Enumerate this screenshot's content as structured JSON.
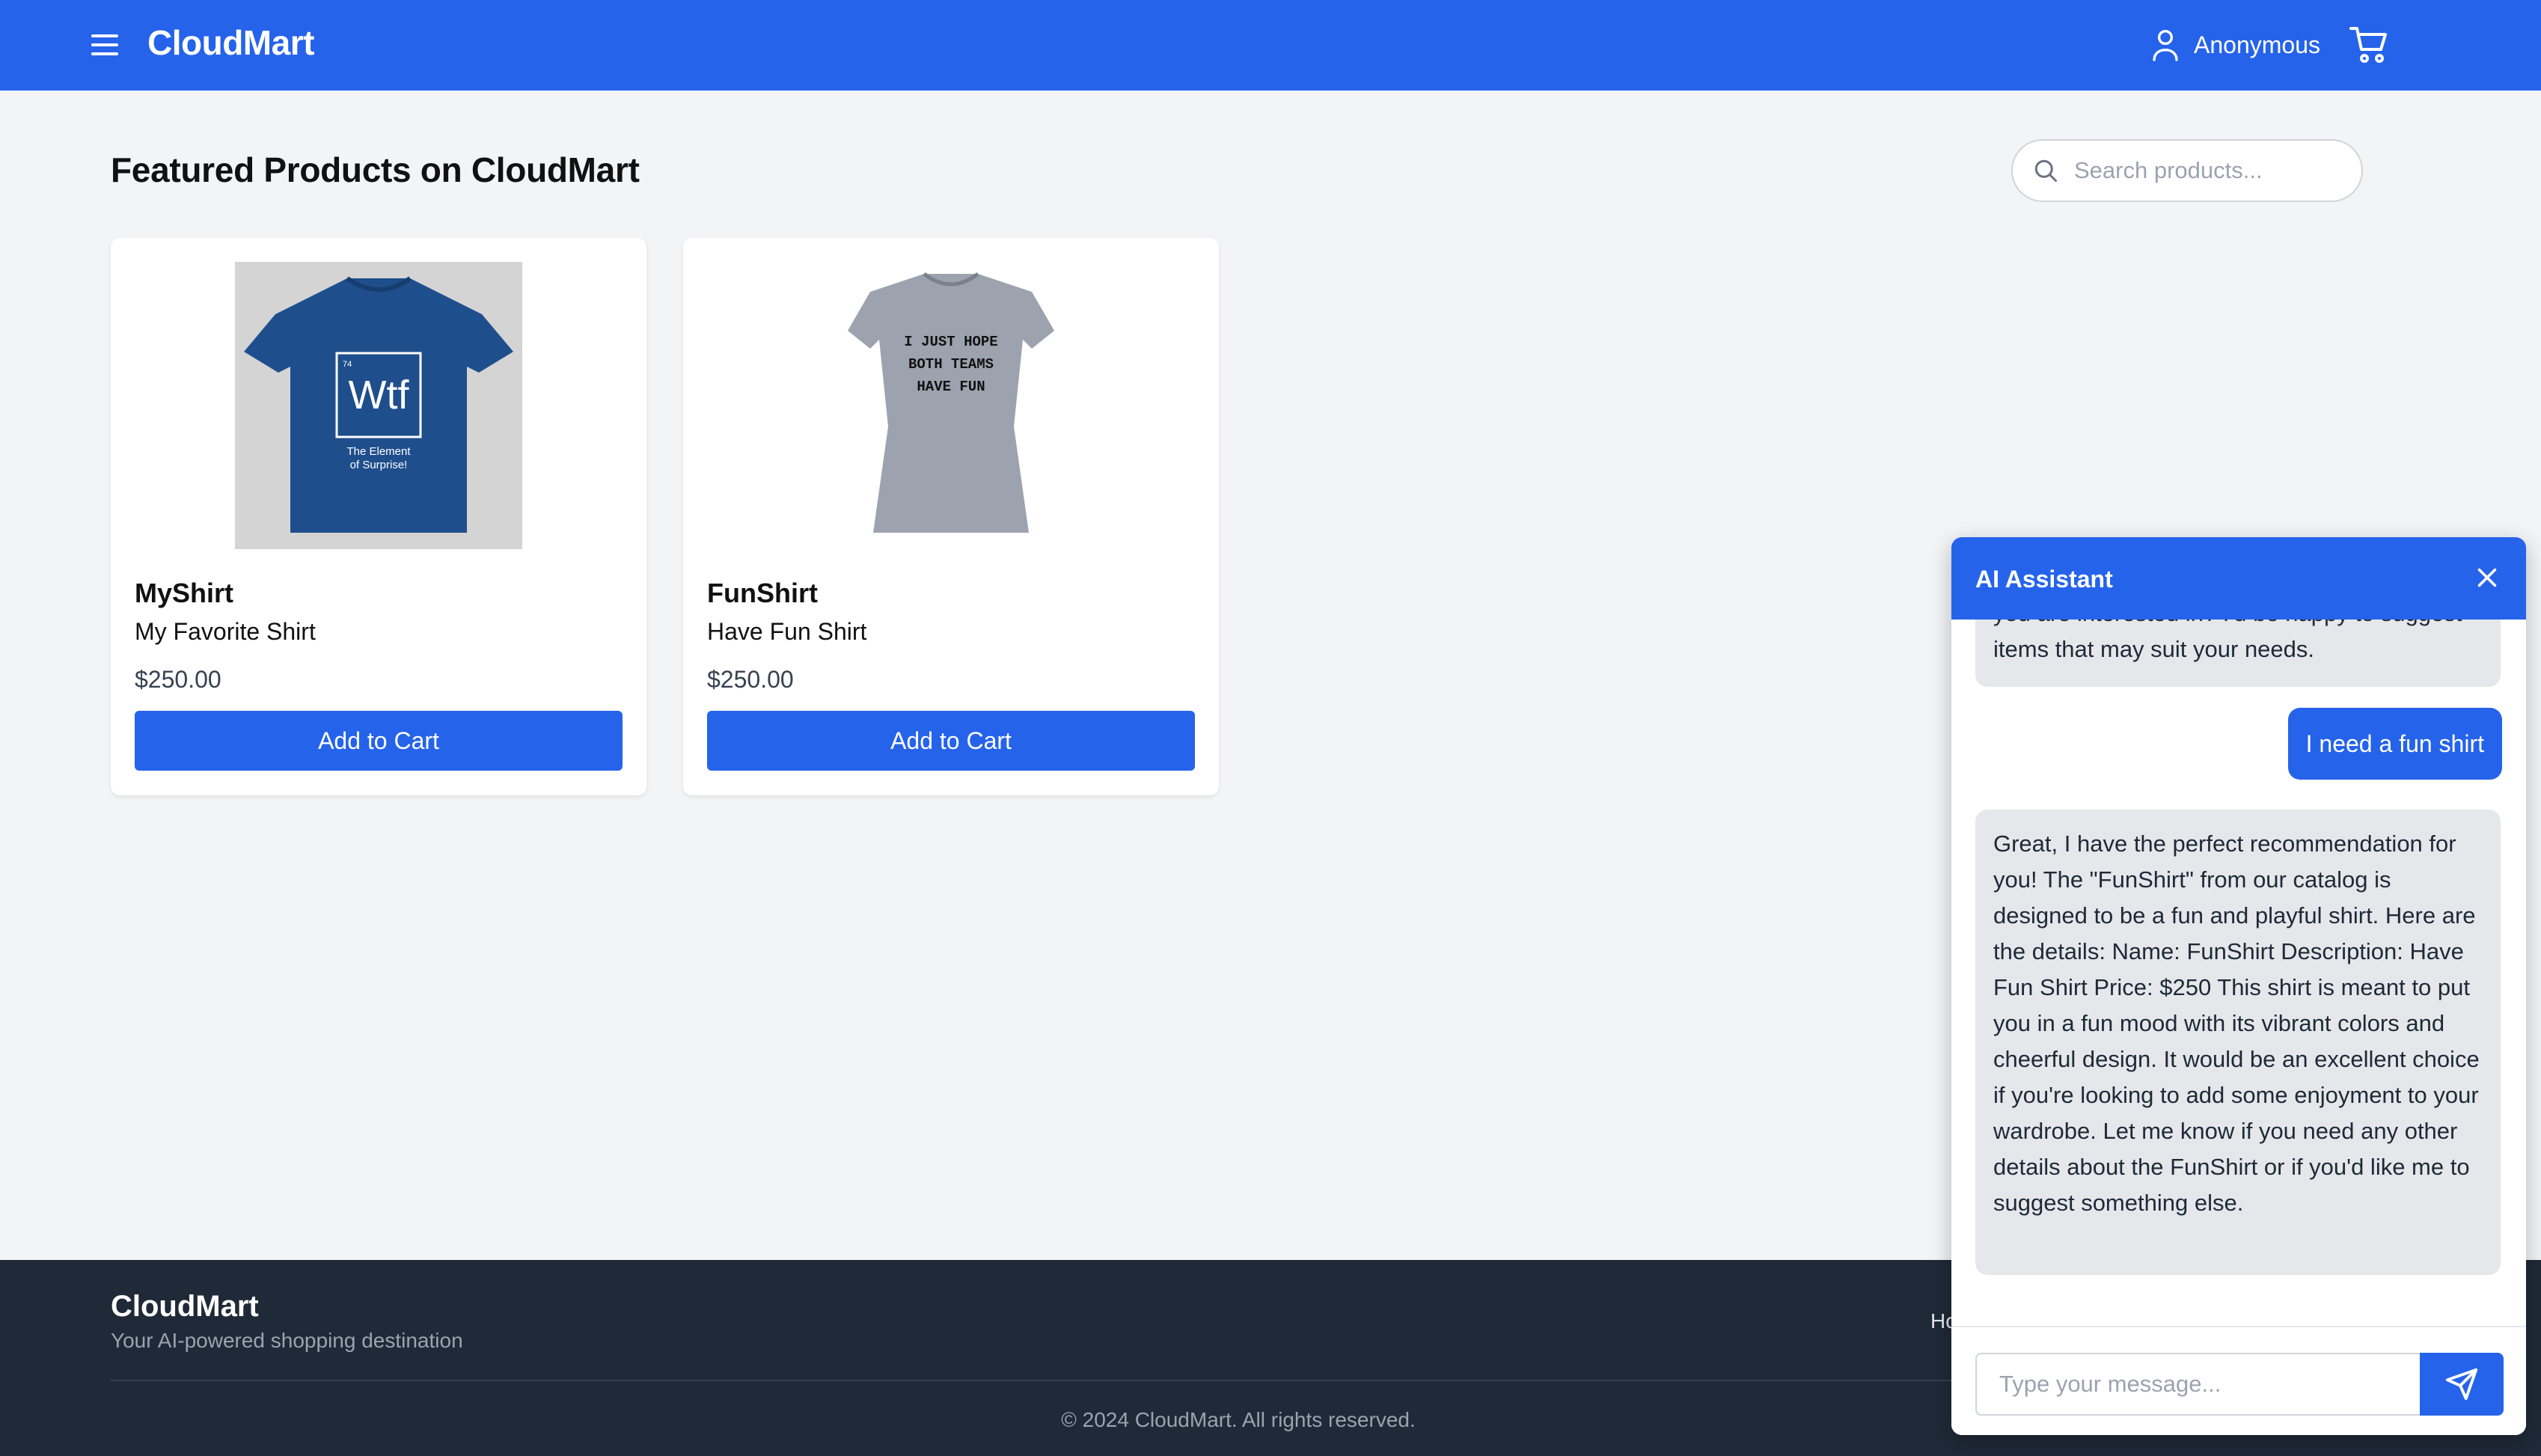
{
  "header": {
    "brand": "CloudMart",
    "user_name": "Anonymous",
    "icons": [
      "menu-icon",
      "user-icon",
      "cart-icon"
    ]
  },
  "main": {
    "title": "Featured Products on CloudMart",
    "search": {
      "placeholder": "Search products...",
      "value": ""
    },
    "products": [
      {
        "name": "MyShirt",
        "description": "My Favorite Shirt",
        "price": "$250.00",
        "button": "Add to Cart",
        "image": {
          "number": "74",
          "symbol": "Wtf",
          "caption1": "The Element",
          "caption2": "of Surprise!",
          "shirt_color": "#1f4e8c"
        }
      },
      {
        "name": "FunShirt",
        "description": "Have Fun Shirt",
        "price": "$250.00",
        "button": "Add to Cart",
        "image": {
          "line1": "I JUST HOPE",
          "line2": "BOTH TEAMS",
          "line3": "HAVE FUN",
          "shirt_color": "#9ca3af"
        }
      }
    ]
  },
  "footer": {
    "brand": "CloudMart",
    "tagline": "Your AI-powered shopping destination",
    "link_partial": "Ho",
    "copyright": "© 2024 CloudMart. All rights reserved."
  },
  "chat": {
    "title": "AI Assistant",
    "messages": [
      {
        "role": "assistant",
        "text": "you are interested in? I'd be happy to suggest items that may suit your needs."
      },
      {
        "role": "user",
        "text": "I need a fun shirt"
      },
      {
        "role": "assistant",
        "text": "Great, I have the perfect recommendation for you! The \"FunShirt\" from our catalog is designed to be a fun and playful shirt. Here are the details: Name: FunShirt Description: Have Fun Shirt Price: $250 This shirt is meant to put you in a fun mood with its vibrant colors and cheerful design. It would be an excellent choice if you're looking to add some enjoyment to your wardrobe. Let me know if you need any other details about the FunShirt or if you'd like me to suggest something else."
      }
    ],
    "input_placeholder": "Type your message...",
    "input_value": ""
  },
  "colors": {
    "primary": "#2563eb",
    "page_bg": "#f3f4f6",
    "footer_bg": "#1f2937",
    "bubble_ai": "#e5e7eb"
  }
}
